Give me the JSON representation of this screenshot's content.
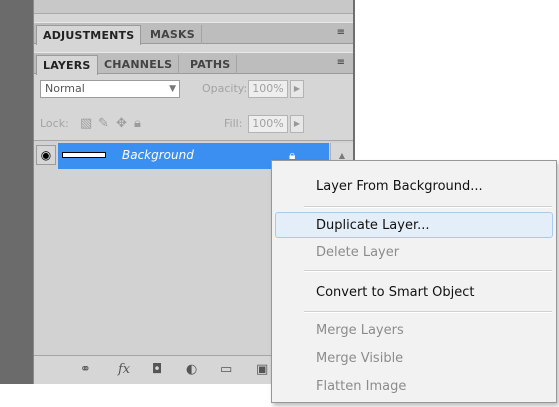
{
  "panels": {
    "top_tabs": [
      {
        "label": "ADJUSTMENTS",
        "active": true
      },
      {
        "label": "MASKS",
        "active": false
      }
    ],
    "layer_tabs": [
      {
        "label": "LAYERS",
        "active": true
      },
      {
        "label": "CHANNELS",
        "active": false
      },
      {
        "label": "PATHS",
        "active": false
      }
    ],
    "menu_icon": "≡"
  },
  "blend": {
    "mode": "Normal",
    "opacity_label": "Opacity:",
    "opacity_value": "100%"
  },
  "lock": {
    "label": "Lock:",
    "fill_label": "Fill:",
    "fill_value": "100%"
  },
  "layers": [
    {
      "name": "Background",
      "selected": true,
      "locked": true
    }
  ],
  "context_menu": {
    "items": [
      {
        "label": "Layer From Background...",
        "enabled": true
      },
      {
        "label": "Duplicate Layer...",
        "enabled": true,
        "highlighted": true
      },
      {
        "label": "Delete Layer",
        "enabled": false
      },
      {
        "label": "Convert to Smart Object",
        "enabled": true
      },
      {
        "label": "Merge Layers",
        "enabled": false
      },
      {
        "label": "Merge Visible",
        "enabled": false
      },
      {
        "label": "Flatten Image",
        "enabled": false
      }
    ]
  },
  "colors": {
    "selection": "#3b8ff0",
    "panel": "#d6d6d6",
    "menu_highlight": "#e3eef9"
  },
  "icons": [
    "eye-icon",
    "lock-icon",
    "link-icon",
    "fx-icon",
    "mask-icon",
    "adjustment-icon",
    "folder-icon",
    "new-layer-icon"
  ]
}
